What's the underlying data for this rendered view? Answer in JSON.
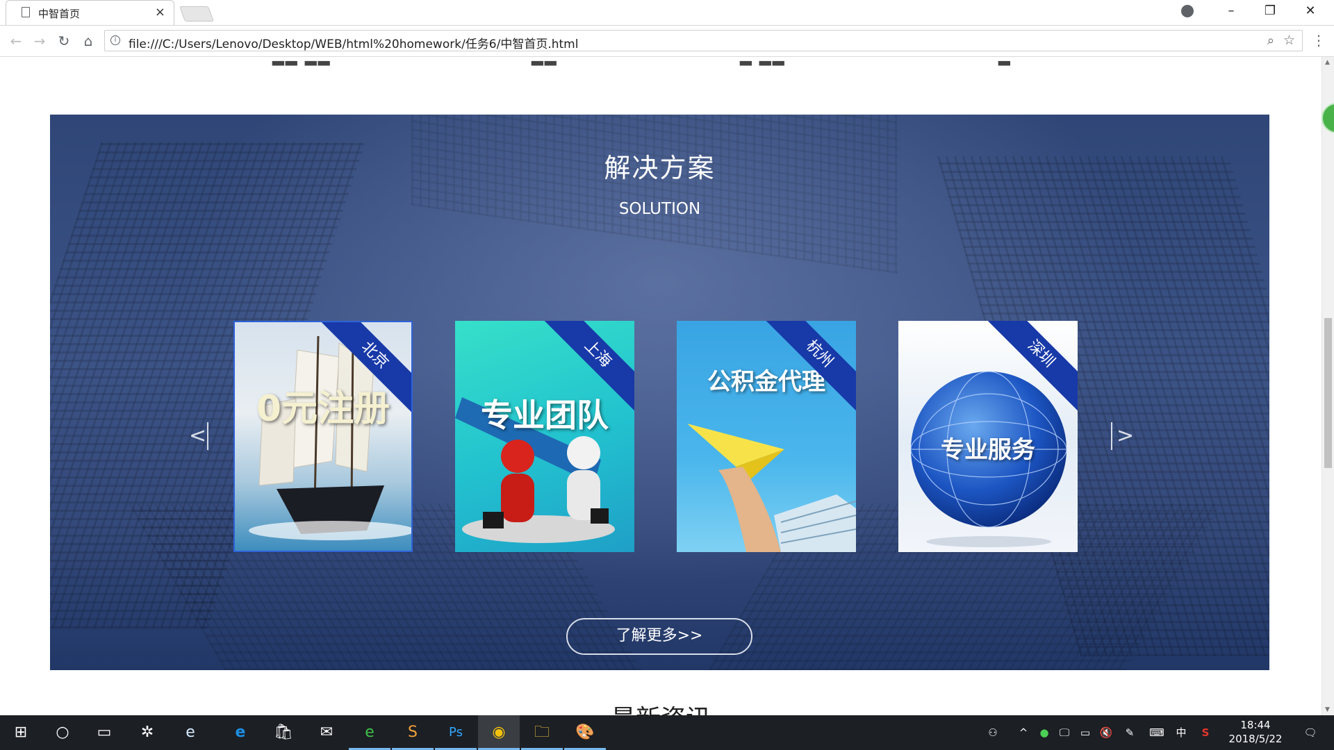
{
  "browser": {
    "tab_title": "中智首页",
    "url": "file:///C:/Users/Lenovo/Desktop/WEB/html%20homework/任务6/中智首页.html",
    "close_glyph": "×",
    "win_min": "–",
    "win_max": "❐",
    "win_close": "✕"
  },
  "solution": {
    "title": "解决方案",
    "subtitle": "SOLUTION",
    "prev_arrow": "<",
    "next_arrow": ">",
    "cards": [
      {
        "city": "北京",
        "headline": "0元注册",
        "colors": [
          "#b9d0e6",
          "#ffffff",
          "#2c7fb0"
        ]
      },
      {
        "city": "上海",
        "headline": "专业团队",
        "colors": [
          "#2ddac8",
          "#25b4c9",
          "#ffffff"
        ]
      },
      {
        "city": "杭州",
        "headline": "公积金代理",
        "colors": [
          "#3aa9e6",
          "#62c8f2",
          "#f3d23b"
        ]
      },
      {
        "city": "深圳",
        "headline": "专业服务",
        "colors": [
          "#e8eef8",
          "#1e56c0",
          "#0c2f8a"
        ]
      }
    ],
    "more_button": "了解更多>>"
  },
  "next_section_title": "最新资讯",
  "taskbar": {
    "time": "18:44",
    "date": "2018/5/22",
    "ime": "中",
    "apps": [
      "windows-start",
      "cortana",
      "task-view",
      "app-fan",
      "internet-explorer",
      "edge",
      "store",
      "mail",
      "360-browser",
      "sublime-text",
      "photoshop",
      "chrome",
      "file-explorer",
      "paint"
    ]
  },
  "colors": {
    "banner_blue": "#34497a",
    "ribbon_blue": "#1839a8",
    "active_border": "#2f62d9"
  }
}
